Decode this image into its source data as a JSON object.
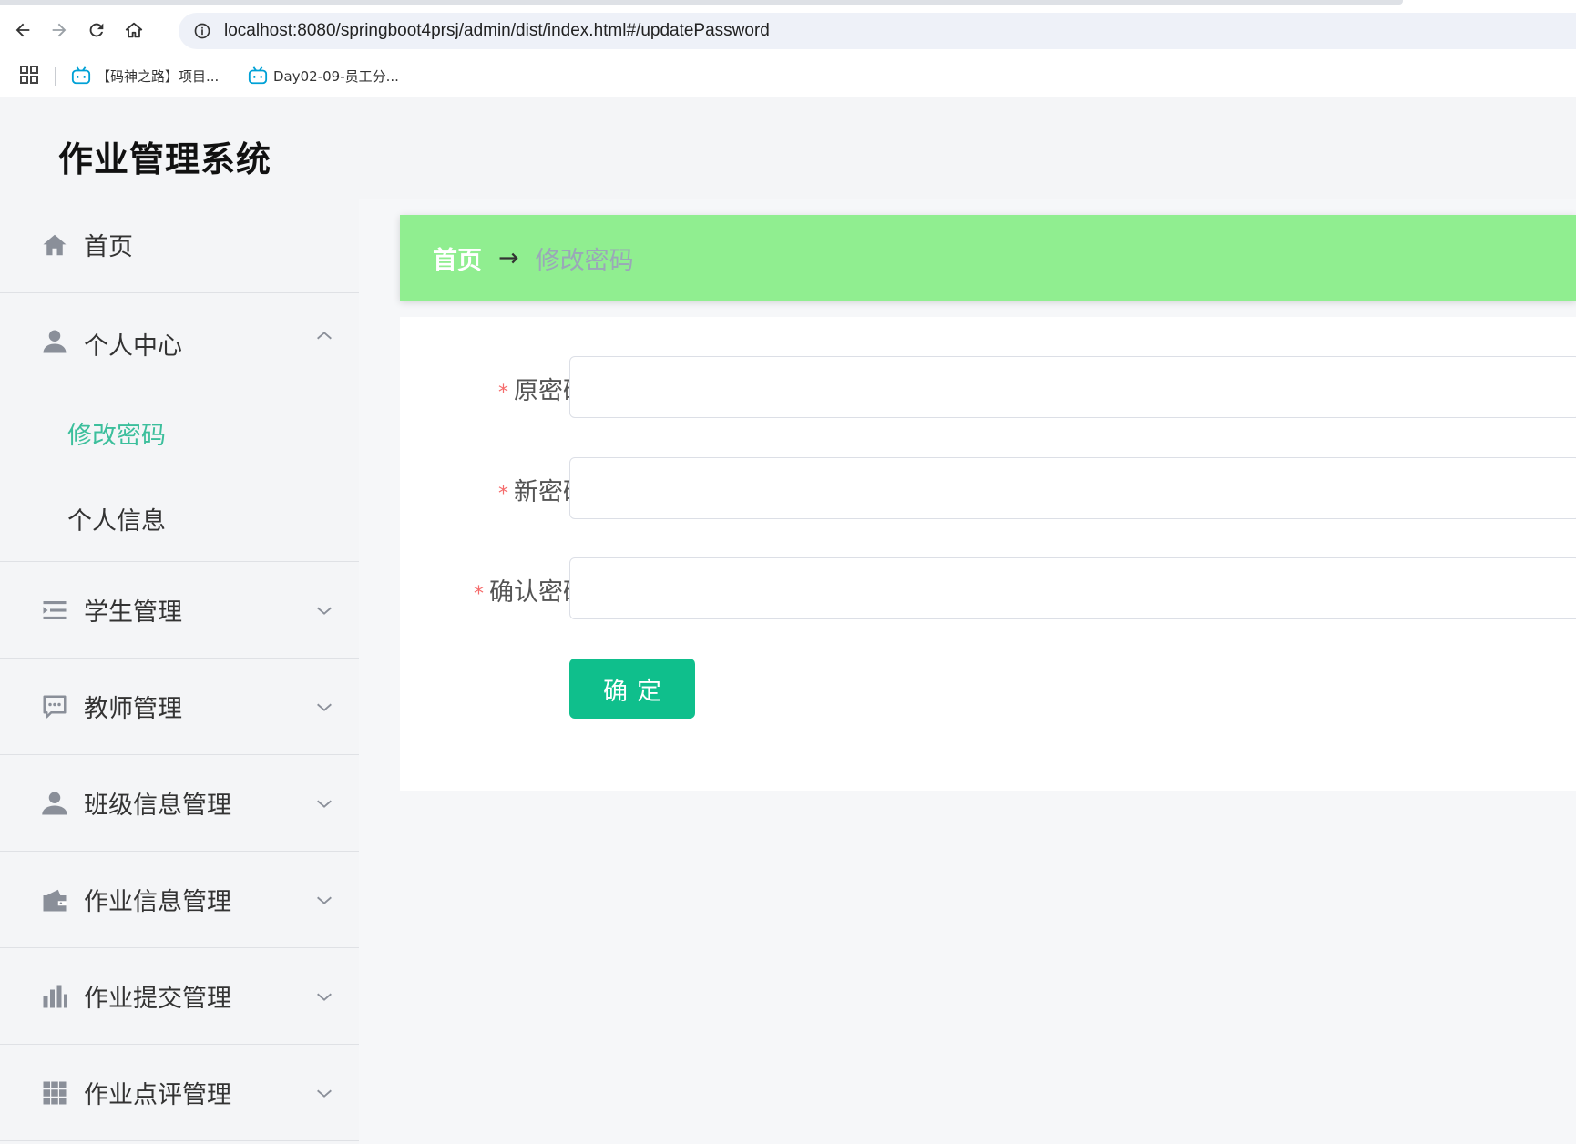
{
  "browser": {
    "url": "localhost:8080/springboot4prsj/admin/dist/index.html#/updatePassword",
    "bookmarks": [
      {
        "label": "【码神之路】项目..."
      },
      {
        "label": "Day02-09-员工分..."
      }
    ]
  },
  "app": {
    "title": "作业管理系统"
  },
  "sidebar": {
    "home": {
      "label": "首页",
      "icon": "home-icon"
    },
    "personal": {
      "label": "个人中心",
      "icon": "user-icon",
      "expanded": true,
      "children": [
        {
          "label": "修改密码",
          "active": true
        },
        {
          "label": "个人信息",
          "active": false
        }
      ]
    },
    "items": [
      {
        "label": "学生管理",
        "icon": "list-icon"
      },
      {
        "label": "教师管理",
        "icon": "message-icon"
      },
      {
        "label": "班级信息管理",
        "icon": "user-icon"
      },
      {
        "label": "作业信息管理",
        "icon": "wallet-icon"
      },
      {
        "label": "作业提交管理",
        "icon": "bar-chart-icon"
      },
      {
        "label": "作业点评管理",
        "icon": "grid-icon"
      }
    ]
  },
  "breadcrumb": {
    "home": "首页",
    "arrow": "→",
    "current": "修改密码"
  },
  "form": {
    "fields": [
      {
        "label": "原密码",
        "required": "*",
        "value": ""
      },
      {
        "label": "新密码",
        "required": "*",
        "value": ""
      },
      {
        "label": "确认密码",
        "required": "*",
        "value": ""
      }
    ],
    "submit_label": "确定"
  },
  "colors": {
    "breadcrumb_bg": "#90ee90",
    "active_menu": "#3cbf9c",
    "button": "#0fbf8c",
    "required": "#f56c6c"
  }
}
